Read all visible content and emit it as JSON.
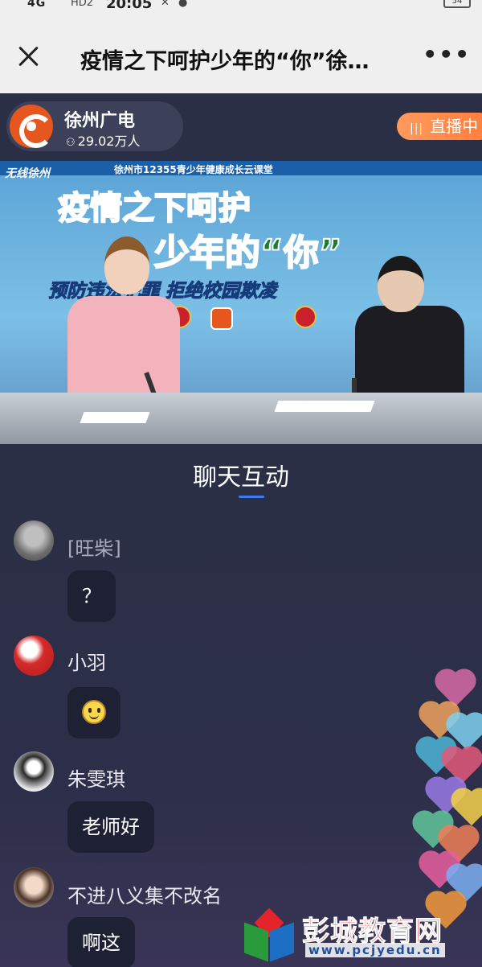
{
  "status_bar": {
    "time": "20:05",
    "battery": "54",
    "signal_label": "4G",
    "network_label": "HD2"
  },
  "title_bar": {
    "title": "疫情之下呵护少年的“你”徐…",
    "close_icon": "close-icon",
    "more_icon": "more-icon"
  },
  "live_header": {
    "channel_name": "徐州广电",
    "viewers": "29.02万人",
    "viewer_icon": "person-icon",
    "live_label": "直播中",
    "live_icon": "equalizer-icon"
  },
  "video": {
    "brand": "无线徐州",
    "subtitle": "徐州市12355青少年健康成长云课堂",
    "headline_1": "疫情之下呵护",
    "headline_2": "少年的“你”",
    "slogan": "预防违法犯罪  拒绝校园欺凌"
  },
  "tab": {
    "label": "聊天互动"
  },
  "chat": {
    "messages": [
      {
        "user": "[旺柴]",
        "text": "？",
        "avatar": "gray-avatar"
      },
      {
        "user": "小羽",
        "text": "",
        "avatar": "red-avatar",
        "emoji": "smile-emoji"
      },
      {
        "user": "朱雯琪",
        "text": "老师好",
        "avatar": "portrait-avatar"
      },
      {
        "user": "不进八义集不改名",
        "text": "啊这",
        "avatar": "girl-avatar"
      }
    ]
  },
  "watermark": {
    "name": "彭城教育网",
    "url": "www.pcjyedu.cn"
  },
  "colors": {
    "accent_live": "#ff8a4a",
    "tab_underline": "#3d7bf0",
    "background": "#2b2f45",
    "watermark_red": "#e02128"
  }
}
